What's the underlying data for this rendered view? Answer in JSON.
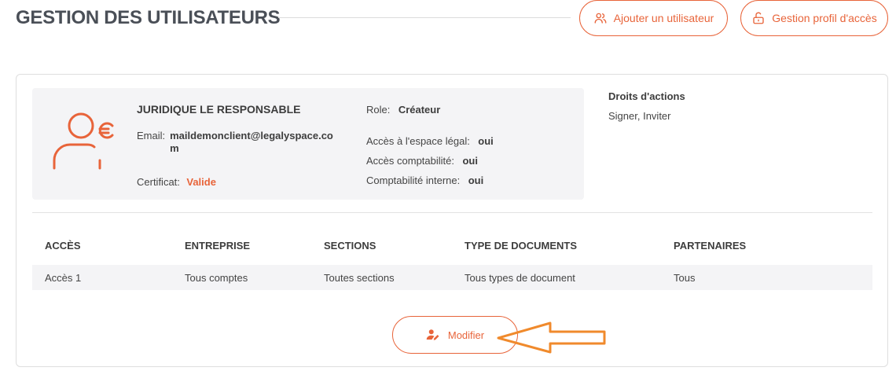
{
  "header": {
    "title": "GESTION DES UTILISATEURS",
    "add_user_label": "Ajouter un utilisateur",
    "profile_label": "Gestion profil d'accès"
  },
  "user": {
    "name": "JURIDIQUE LE RESPONSABLE",
    "email_label": "Email:",
    "email": "maildemonclient@legalyspace.com",
    "certificate_label": "Certificat:",
    "certificate_value": "Valide",
    "role_label": "Role:",
    "role_value": "Créateur",
    "access": [
      {
        "label": "Accès à l'espace légal:",
        "value": "oui"
      },
      {
        "label": "Accès comptabilité:",
        "value": "oui"
      },
      {
        "label": "Comptabilité interne:",
        "value": "oui"
      }
    ]
  },
  "rights": {
    "title": "Droits d'actions",
    "value": "Signer, Inviter"
  },
  "table": {
    "columns": [
      "ACCÈS",
      "ENTREPRISE",
      "SECTIONS",
      "TYPE DE DOCUMENTS",
      "PARTENAIRES"
    ],
    "rows": [
      [
        "Accès 1",
        "Tous comptes",
        "Toutes sections",
        "Tous types de document",
        "Tous"
      ]
    ]
  },
  "actions": {
    "modify_label": "Modifier"
  },
  "icons": {
    "add_user": "users-icon",
    "profile": "unlock-icon",
    "avatar": "user-euro-icon",
    "modify": "user-edit-icon",
    "annotation": "arrow-left-icon"
  },
  "colors": {
    "accent": "#e8643a",
    "arrow": "#f08a2c",
    "panel": "#f4f4f6"
  }
}
